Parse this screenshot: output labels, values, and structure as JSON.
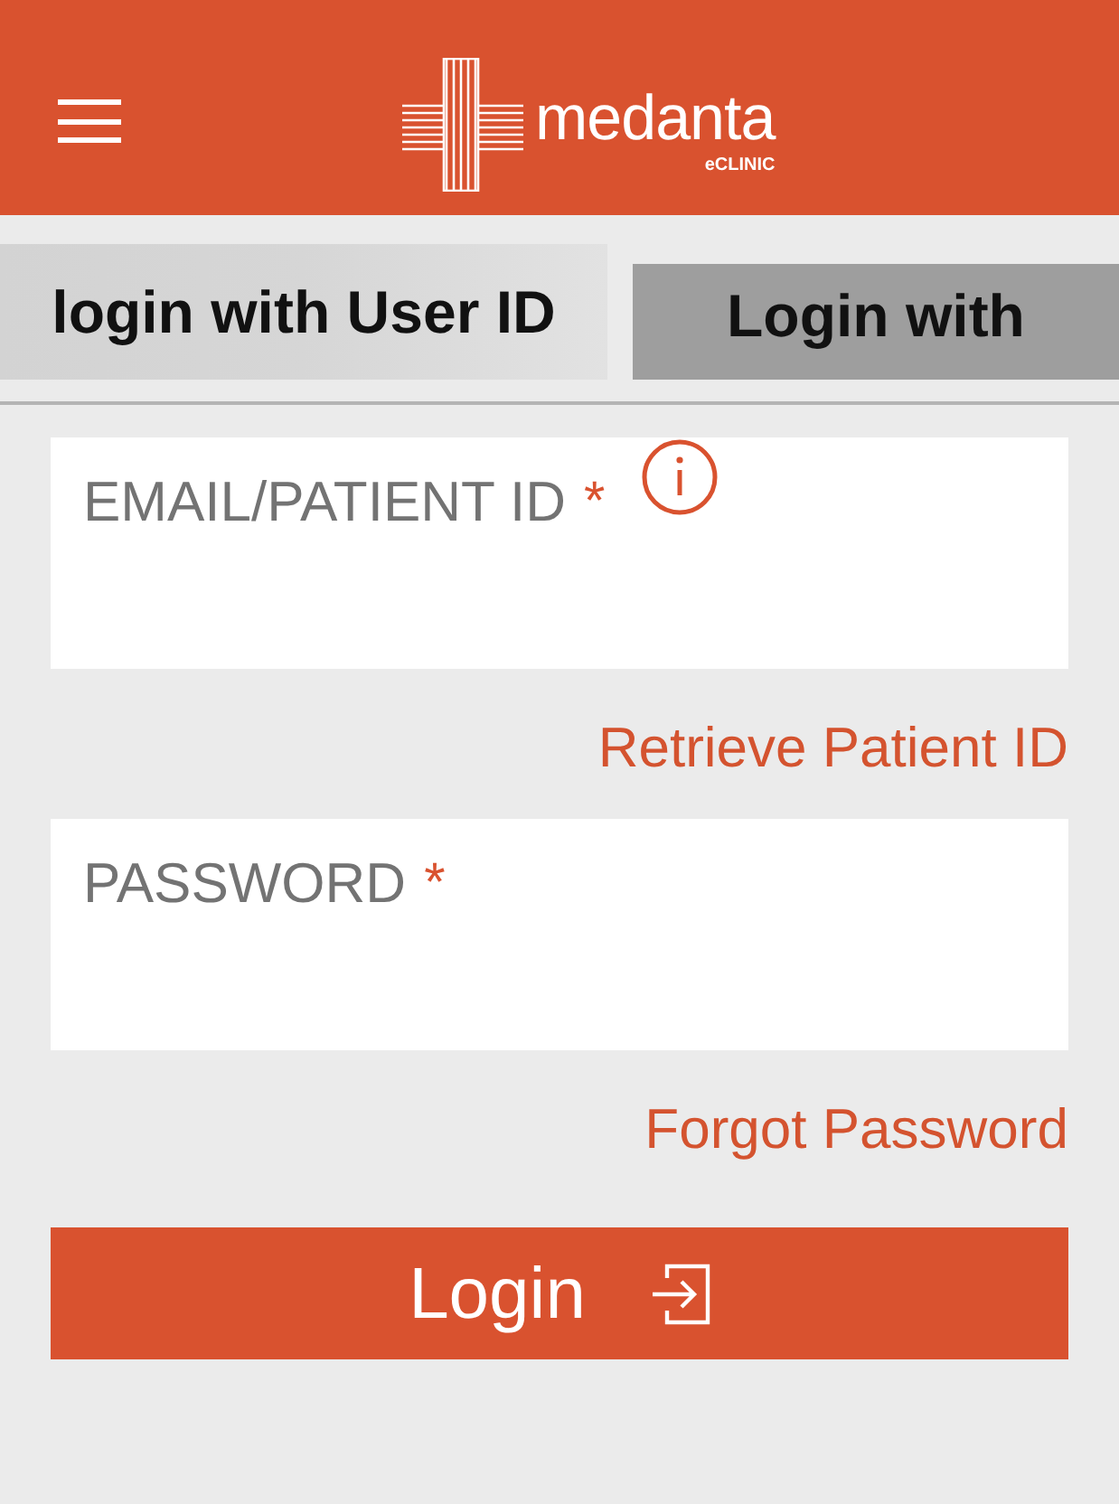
{
  "header": {
    "logo": {
      "wordmark": "medanta",
      "subtitle": "eCLINIC"
    }
  },
  "tabs": [
    {
      "label": "login with User ID",
      "selected": true
    },
    {
      "label": "Login with",
      "selected": false
    }
  ],
  "fields": [
    {
      "label": "EMAIL/PATIENT ID",
      "required_mark": "*",
      "info": true,
      "link": "Retrieve Patient ID"
    },
    {
      "label": "PASSWORD",
      "required_mark": "*",
      "info": false,
      "link": "Forgot Password"
    }
  ],
  "login_button": {
    "label": "Login"
  }
}
